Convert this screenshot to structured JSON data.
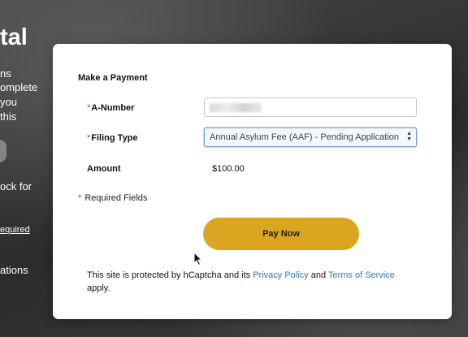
{
  "background": {
    "title_fragment": "tal",
    "text_lines": [
      "ns",
      "omplete",
      "you",
      "this",
      "ock for",
      "equired",
      "ations"
    ]
  },
  "modal": {
    "heading": "Make a Payment",
    "a_number": {
      "required_mark": "*",
      "label": "A-Number",
      "value": ""
    },
    "filing_type": {
      "required_mark": "*",
      "label": "Filing Type",
      "selected": "Annual Asylum Fee (AAF) - Pending Application"
    },
    "amount": {
      "label": "Amount",
      "value": "$100.00"
    },
    "required_note": {
      "mark": "*",
      "text": "Required Fields"
    },
    "pay_button": "Pay Now",
    "captcha": {
      "text_before": "This site is protected by hCaptcha and its ",
      "privacy_link": "Privacy Policy",
      "text_and": " and ",
      "terms_link": "Terms of Service",
      "text_after": " apply."
    }
  },
  "colors": {
    "pay_button": "#daa520",
    "link": "#2a7ab8",
    "required": "#c0392b"
  }
}
